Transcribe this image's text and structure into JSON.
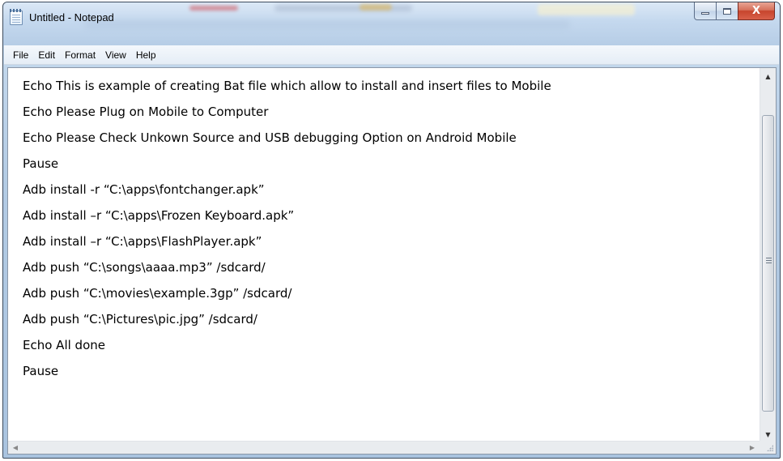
{
  "window": {
    "title": "Untitled - Notepad",
    "close_glyph": "X"
  },
  "menu": {
    "items": [
      "File",
      "Edit",
      "Format",
      "View",
      "Help"
    ]
  },
  "editor": {
    "lines": [
      "Echo This is example of creating Bat file which allow to install and insert files to Mobile",
      "Echo Please Plug on Mobile to Computer",
      "Echo Please Check Unkown Source and USB debugging Option on Android Mobile",
      "Pause",
      "Adb install -r “C:\\apps\\fontchanger.apk”",
      "Adb install –r “C:\\apps\\Frozen Keyboard.apk”",
      "Adb install –r “C:\\apps\\FlashPlayer.apk”",
      "Adb push “C:\\songs\\aaaa.mp3” /sdcard/",
      "Adb push “C:\\movies\\example.3gp” /sdcard/",
      "Adb push “C:\\Pictures\\pic.jpg” /sdcard/",
      "Echo All done",
      "Pause"
    ]
  },
  "icons": {
    "app": "notepad-icon",
    "minimize": "minimize-icon",
    "maximize": "maximize-icon",
    "close": "close-icon"
  }
}
